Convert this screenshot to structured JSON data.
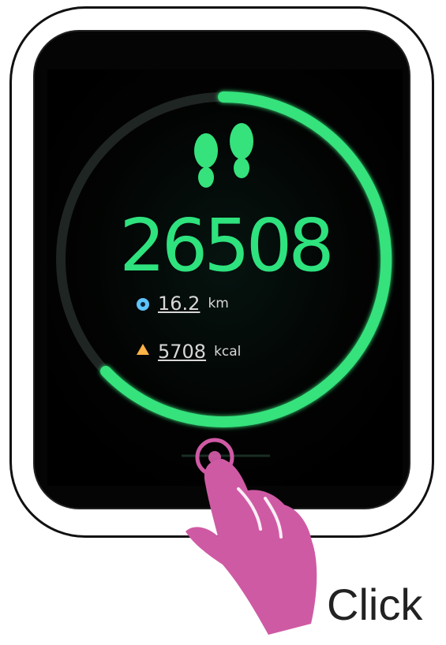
{
  "watch_face": {
    "steps": "26508",
    "distance": {
      "value": "16.2",
      "unit": "km"
    },
    "calories": {
      "value": "5708",
      "unit": "kcal"
    },
    "progress_ring_color": "#35e27c",
    "footsteps_icon": "footsteps-icon",
    "distance_icon": "distance-icon",
    "calories_icon": "calories-icon"
  },
  "instruction": {
    "text": "Click",
    "gesture_icon": "tap-hand-icon",
    "gesture_color": "#cf5aa4"
  }
}
